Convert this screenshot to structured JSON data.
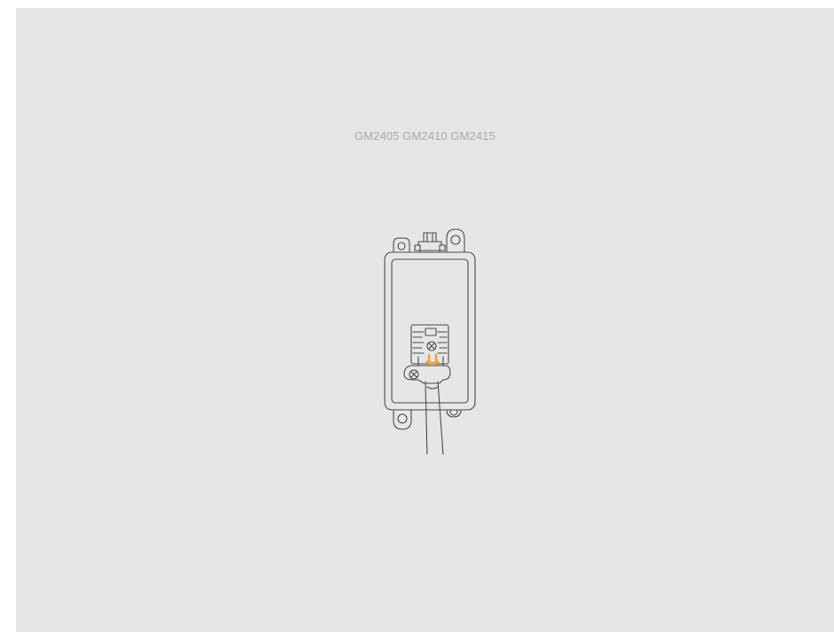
{
  "caption": {
    "models": "GM2405 GM2410 GM2415"
  },
  "illustration": {
    "subject": "wall-mounted-unit-with-cable-clamp",
    "colors": {
      "background": "#e6e6e7",
      "line": "#4a4a4a",
      "highlight": "#f0a030",
      "caption_text": "#a9a9ac"
    }
  }
}
